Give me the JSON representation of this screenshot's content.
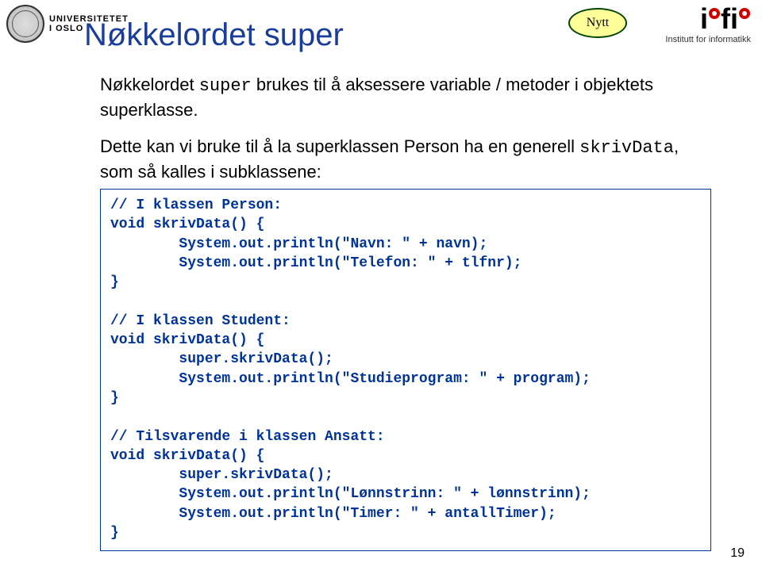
{
  "header": {
    "university_line1": "UNIVERSITETET",
    "university_line2": "I OSLO",
    "ifi_caption": "Institutt for informatikk"
  },
  "badge": {
    "label": "Nytt"
  },
  "title": {
    "prefix": "Nøkkelordet ",
    "keyword": "super"
  },
  "paragraph1": {
    "part1": "Nøkkelordet ",
    "mono": "super",
    "part2": " brukes til å aksessere variable / metoder i objektets superklasse."
  },
  "paragraph2": {
    "part1": "Dette kan vi bruke til å la superklassen Person ha en generell ",
    "mono": "skrivData",
    "part2": ", som så kalles i subklassene:"
  },
  "code": {
    "l01": "// I klassen Person:",
    "l02": "void skrivData() {",
    "l03": "        System.out.println(\"Navn: \" + navn);",
    "l04": "        System.out.println(\"Telefon: \" + tlfnr);",
    "l05": "}",
    "l06": "",
    "l07": "// I klassen Student:",
    "l08": "void skrivData() {",
    "l09": "        super.skrivData();",
    "l10": "        System.out.println(\"Studieprogram: \" + program);",
    "l11": "}",
    "l12": "",
    "l13": "// Tilsvarende i klassen Ansatt:",
    "l14": "void skrivData() {",
    "l15": "        super.skrivData();",
    "l16": "        System.out.println(\"Lønnstrinn: \" + lønnstrinn);",
    "l17": "        System.out.println(\"Timer: \" + antallTimer);",
    "l18": "}"
  },
  "page_number": "19"
}
